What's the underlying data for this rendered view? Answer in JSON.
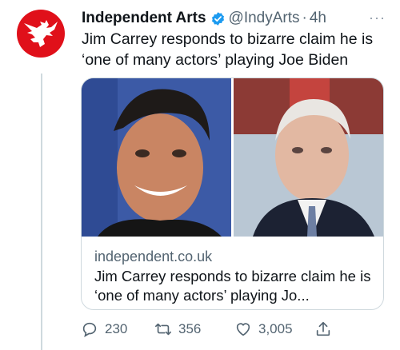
{
  "tweet": {
    "author_name": "Independent Arts",
    "handle": "@IndyArts",
    "separator": "·",
    "time": "4h",
    "more_label": "···",
    "text": "Jim Carrey responds to bizarre claim he is ‘one of many actors’ playing Joe Biden",
    "card": {
      "domain": "independent.co.uk",
      "title": "Jim Carrey responds to bizarre claim he is ‘one of many actors’ playing Jo..."
    },
    "actions": {
      "replies": "230",
      "retweets": "356",
      "likes": "3,005"
    }
  },
  "icons": {
    "avatar": "independent-eagle-logo",
    "verified": "verified-badge-icon",
    "reply": "reply-icon",
    "retweet": "retweet-icon",
    "like": "heart-icon",
    "share": "share-icon"
  },
  "colors": {
    "brand_red": "#e0101a",
    "verified_blue": "#1d9bf0",
    "secondary_text": "#536471"
  }
}
